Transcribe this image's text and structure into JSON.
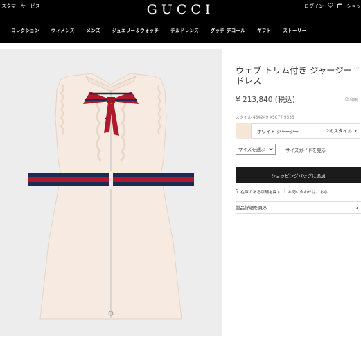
{
  "header": {
    "customer_service": "スタマーサービス",
    "logo": "GUCCI",
    "login": "ログイン",
    "wishlist_icon": "heart-icon",
    "bag_icon": "shopping-bag-icon",
    "shop_label": "ショッ"
  },
  "nav": {
    "items": [
      "コレクション",
      "ウィメンズ",
      "メンズ",
      "ジュエリー＆ウォッチ",
      "チルドレンズ",
      "グッチ デコール",
      "ギフト",
      "ストーリー"
    ]
  },
  "product": {
    "title": "ウェブ トリム付き ジャージー ドレス",
    "price": "¥ 213,840 (税込)",
    "print_label": "印刷",
    "style_number": "スタイル 434249 X5C77 9535",
    "color_name": "ホワイト ジャージー",
    "styles_link": "2のスタイル",
    "size_select": "サイズを選ぶ",
    "size_guide": "サイズガイドを見る",
    "cart_button": "ショッピングバッグに追加",
    "store_link": "在庫のある店舗を探す",
    "contact_link": "お問い合わせはこちら",
    "details_link": "製品詳細を見る"
  },
  "colors": {
    "topbar": "#000000",
    "swatch": "#f6e6d8",
    "dress": "#f7ebe1",
    "web_red": "#b0192b",
    "web_navy": "#1d2b52",
    "cart_button": "#1b1b1b"
  }
}
